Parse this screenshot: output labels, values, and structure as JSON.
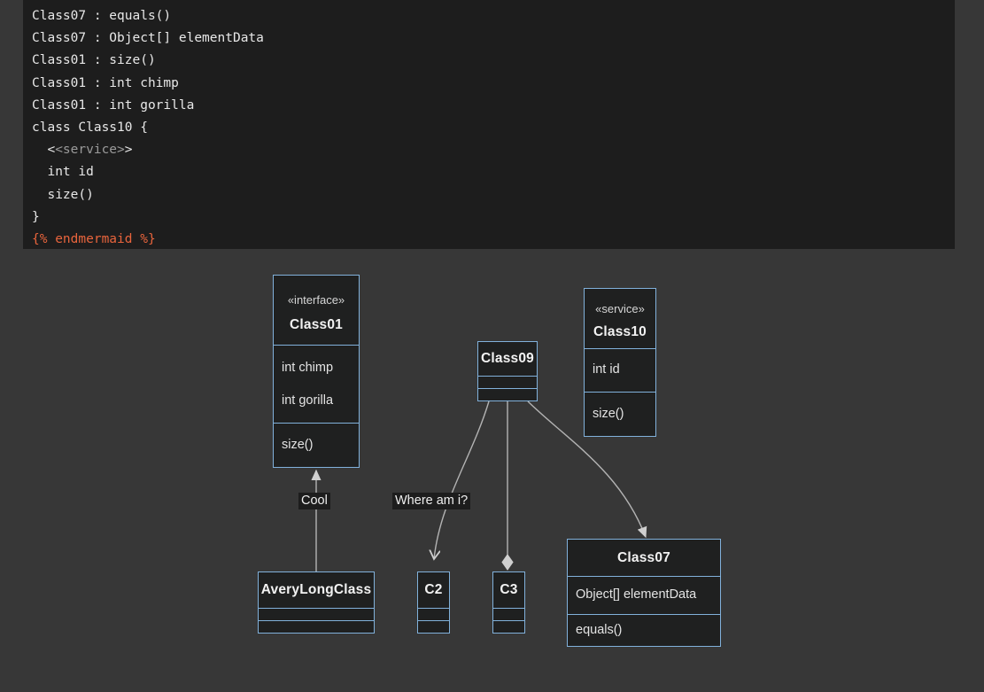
{
  "code_block": {
    "language": "mermaid-markdown",
    "lines": [
      {
        "parts": [
          {
            "t": "Class07 : equals()",
            "cls": "plain"
          }
        ]
      },
      {
        "parts": [
          {
            "t": "Class07 : Object[] elementData",
            "cls": "plain"
          }
        ]
      },
      {
        "parts": [
          {
            "t": "Class01 : size()",
            "cls": "plain"
          }
        ]
      },
      {
        "parts": [
          {
            "t": "Class01 : int chimp",
            "cls": "plain"
          }
        ]
      },
      {
        "parts": [
          {
            "t": "Class01 : int gorilla",
            "cls": "plain"
          }
        ]
      },
      {
        "parts": [
          {
            "t": "class Class10 {",
            "cls": "plain"
          }
        ]
      },
      {
        "parts": [
          {
            "t": "  <",
            "cls": "plain"
          },
          {
            "t": "<service>",
            "cls": "tok-tag"
          },
          {
            "t": ">",
            "cls": "plain"
          }
        ]
      },
      {
        "parts": [
          {
            "t": "  int id",
            "cls": "plain"
          }
        ]
      },
      {
        "parts": [
          {
            "t": "  size()",
            "cls": "plain"
          }
        ]
      },
      {
        "parts": [
          {
            "t": "}",
            "cls": "plain"
          }
        ]
      },
      {
        "parts": [
          {
            "t": "{% endmermaid %}",
            "cls": "tok-liquid"
          }
        ]
      }
    ]
  },
  "colors": {
    "page_background": "#373737",
    "code_background": "#1d1d1d",
    "node_fill": "#1f2020",
    "node_border": "#81b1db",
    "edge_stroke": "#b3b3b3",
    "text": "#ececec",
    "liquid_tag": "#e8643c",
    "html_tag": "#9a9a9a"
  },
  "diagram": {
    "type": "uml-class-diagram",
    "nodes": [
      {
        "id": "Class01",
        "stereotype": "«interface»",
        "title": "Class01",
        "attributes": [
          "int chimp",
          "int gorilla"
        ],
        "methods": [
          "size()"
        ]
      },
      {
        "id": "Class09",
        "stereotype": "",
        "title": "Class09",
        "attributes": [],
        "methods": []
      },
      {
        "id": "Class10",
        "stereotype": "«service»",
        "title": "Class10",
        "attributes": [
          "int id"
        ],
        "methods": [
          "size()"
        ]
      },
      {
        "id": "Class07",
        "stereotype": "",
        "title": "Class07",
        "attributes": [
          "Object[] elementData"
        ],
        "methods": [
          "equals()"
        ]
      },
      {
        "id": "AveryLongClass",
        "stereotype": "",
        "title": "AveryLongClass",
        "attributes": [],
        "methods": []
      },
      {
        "id": "C2",
        "stereotype": "",
        "title": "C2",
        "attributes": [],
        "methods": []
      },
      {
        "id": "C3",
        "stereotype": "",
        "title": "C3",
        "attributes": [],
        "methods": []
      }
    ],
    "edges": [
      {
        "from": "AveryLongClass",
        "to": "Class01",
        "label": "Cool",
        "arrow": "hollow-triangle"
      },
      {
        "from": "Class09",
        "to": "C2",
        "label": "Where am i?",
        "arrow": "open-arrow"
      },
      {
        "from": "Class09",
        "to": "C3",
        "label": "",
        "arrow": "filled-diamond"
      },
      {
        "from": "Class09",
        "to": "Class07",
        "label": "",
        "arrow": "hollow-triangle"
      }
    ],
    "labels": {
      "cool": "Cool",
      "where_am_i": "Where am i?"
    }
  }
}
